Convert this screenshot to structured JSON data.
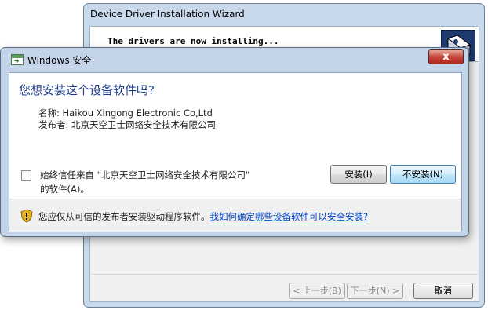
{
  "wizard": {
    "title": "Device Driver Installation Wizard",
    "message": "The drivers are now installing...",
    "buttons": {
      "back": "< 上一步(B)",
      "next": "下一步(N) >",
      "cancel": "取消"
    }
  },
  "dialog": {
    "title": "Windows 安全",
    "close_symbol": "x",
    "question": "您想安装这个设备软件吗?",
    "name_line": "名称: Haikou Xingong Electronic Co,Ltd",
    "publisher_line": "发布者: 北京天空卫士网络安全技术有限公司",
    "trust_checkbox_label": "始终信任来自 \"北京天空卫士网络安全技术有限公司\" 的软件(A)。",
    "trust_checked": false,
    "install_button": "安装(I)",
    "dont_install_button": "不安装(N)",
    "footer_text": "您应仅从可信的发布者安装驱动程序软件。",
    "footer_link": "我如何确定哪些设备软件可以安全安装?"
  },
  "icons": {
    "app": "security-app-icon",
    "close": "close-icon",
    "shield": "warning-shield-icon",
    "wizard_logo": "driver-wizard-logo-icon"
  },
  "colors": {
    "accent_blue": "#1e3c8c",
    "link": "#0045c8",
    "close_red": "#c5453a",
    "frame": "#c4d5ea"
  }
}
